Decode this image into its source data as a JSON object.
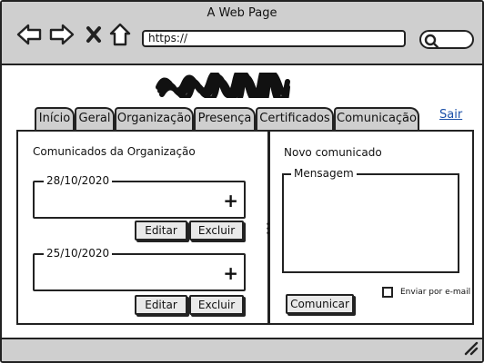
{
  "window": {
    "title": "A Web Page"
  },
  "browser": {
    "url": "https://"
  },
  "tabs": [
    {
      "label": "Início"
    },
    {
      "label": "Geral"
    },
    {
      "label": "Organização"
    },
    {
      "label": "Presença"
    },
    {
      "label": "Certificados"
    },
    {
      "label": "Comunicação",
      "active": true
    }
  ],
  "header": {
    "logout_label": "Sair"
  },
  "left_panel": {
    "title": "Comunicados da Organização",
    "posts": [
      {
        "date": "28/10/2020",
        "edit_label": "Editar",
        "delete_label": "Excluir"
      },
      {
        "date": "25/10/2020",
        "edit_label": "Editar",
        "delete_label": "Excluir"
      }
    ]
  },
  "right_panel": {
    "title": "Novo comunicado",
    "message_legend": "Mensagem",
    "message_value": "",
    "submit_label": "Comunicar",
    "email_checkbox_label": "Enviar por e-mail",
    "email_checked": false
  },
  "icons": {
    "add": "plus-icon",
    "back": "arrow-left-icon",
    "forward": "arrow-right-icon",
    "close": "close-icon",
    "home": "home-icon",
    "search": "search-icon"
  }
}
